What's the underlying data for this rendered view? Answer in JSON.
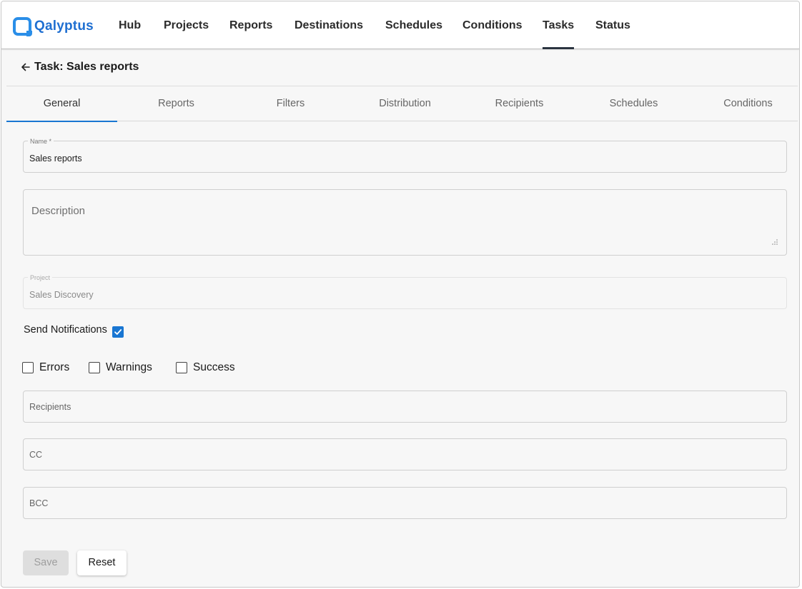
{
  "app": {
    "logo_text": "Qalyptus"
  },
  "nav": {
    "items": [
      {
        "label": "Hub"
      },
      {
        "label": "Projects"
      },
      {
        "label": "Reports"
      },
      {
        "label": "Destinations"
      },
      {
        "label": "Schedules"
      },
      {
        "label": "Conditions"
      },
      {
        "label": "Tasks",
        "active": true
      },
      {
        "label": "Status"
      }
    ]
  },
  "header": {
    "title": "Task: Sales reports"
  },
  "tabs": [
    {
      "label": "General",
      "active": true
    },
    {
      "label": "Reports"
    },
    {
      "label": "Filters"
    },
    {
      "label": "Distribution"
    },
    {
      "label": "Recipients"
    },
    {
      "label": "Schedules"
    },
    {
      "label": "Conditions"
    }
  ],
  "form": {
    "name": {
      "label": "Name *",
      "value": "Sales reports"
    },
    "description": {
      "placeholder": "Description",
      "value": ""
    },
    "project": {
      "label": "Project",
      "value": "Sales Discovery",
      "disabled": true
    },
    "send_notifications": {
      "label": "Send Notifications",
      "checked": true
    },
    "notify_options": [
      {
        "label": "Errors",
        "checked": false
      },
      {
        "label": "Warnings",
        "checked": false
      },
      {
        "label": "Success",
        "checked": false
      }
    ],
    "recipients": {
      "placeholder": "Recipients"
    },
    "cc": {
      "placeholder": "CC"
    },
    "bcc": {
      "placeholder": "BCC"
    }
  },
  "buttons": {
    "save": "Save",
    "reset": "Reset"
  },
  "colors": {
    "accent": "#1976d2",
    "logo": "#1f6fd1",
    "nav_active_underline": "#2b3440"
  }
}
